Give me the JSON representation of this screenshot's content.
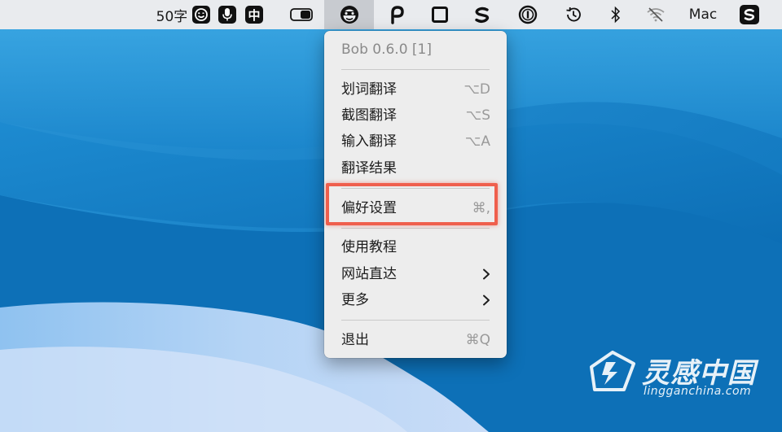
{
  "menubar": {
    "word_count": "50字",
    "input_method_label": "中",
    "wifi_label": "Mac",
    "icons": [
      "emoji-face-icon",
      "microphone-icon",
      "input-method-icon",
      "toggle-icon",
      "bob-translate-icon",
      "p-app-icon",
      "square-app-icon",
      "s-app-icon",
      "onepassword-icon",
      "time-machine-icon",
      "bluetooth-icon",
      "wifi-off-icon",
      "sogou-input-icon"
    ]
  },
  "menu": {
    "header": "Bob 0.6.0 [1]",
    "items": [
      {
        "label": "划词翻译",
        "shortcut": "⌥D"
      },
      {
        "label": "截图翻译",
        "shortcut": "⌥S"
      },
      {
        "label": "输入翻译",
        "shortcut": "⌥A"
      },
      {
        "label": "翻译结果",
        "shortcut": ""
      },
      {
        "label": "偏好设置",
        "shortcut": "⌘,"
      },
      {
        "label": "使用教程",
        "shortcut": ""
      },
      {
        "label": "网站直达",
        "shortcut": ""
      },
      {
        "label": "更多",
        "shortcut": ""
      },
      {
        "label": "退出",
        "shortcut": "⌘Q"
      }
    ]
  },
  "watermark": {
    "title": "灵感中国",
    "url": "lingganchina.com"
  },
  "colors": {
    "highlight": "#ef5f4d",
    "wallpaper_blue": "#1780c9",
    "menubar_bg": "#e9ebee",
    "menu_bg": "#ededed"
  }
}
